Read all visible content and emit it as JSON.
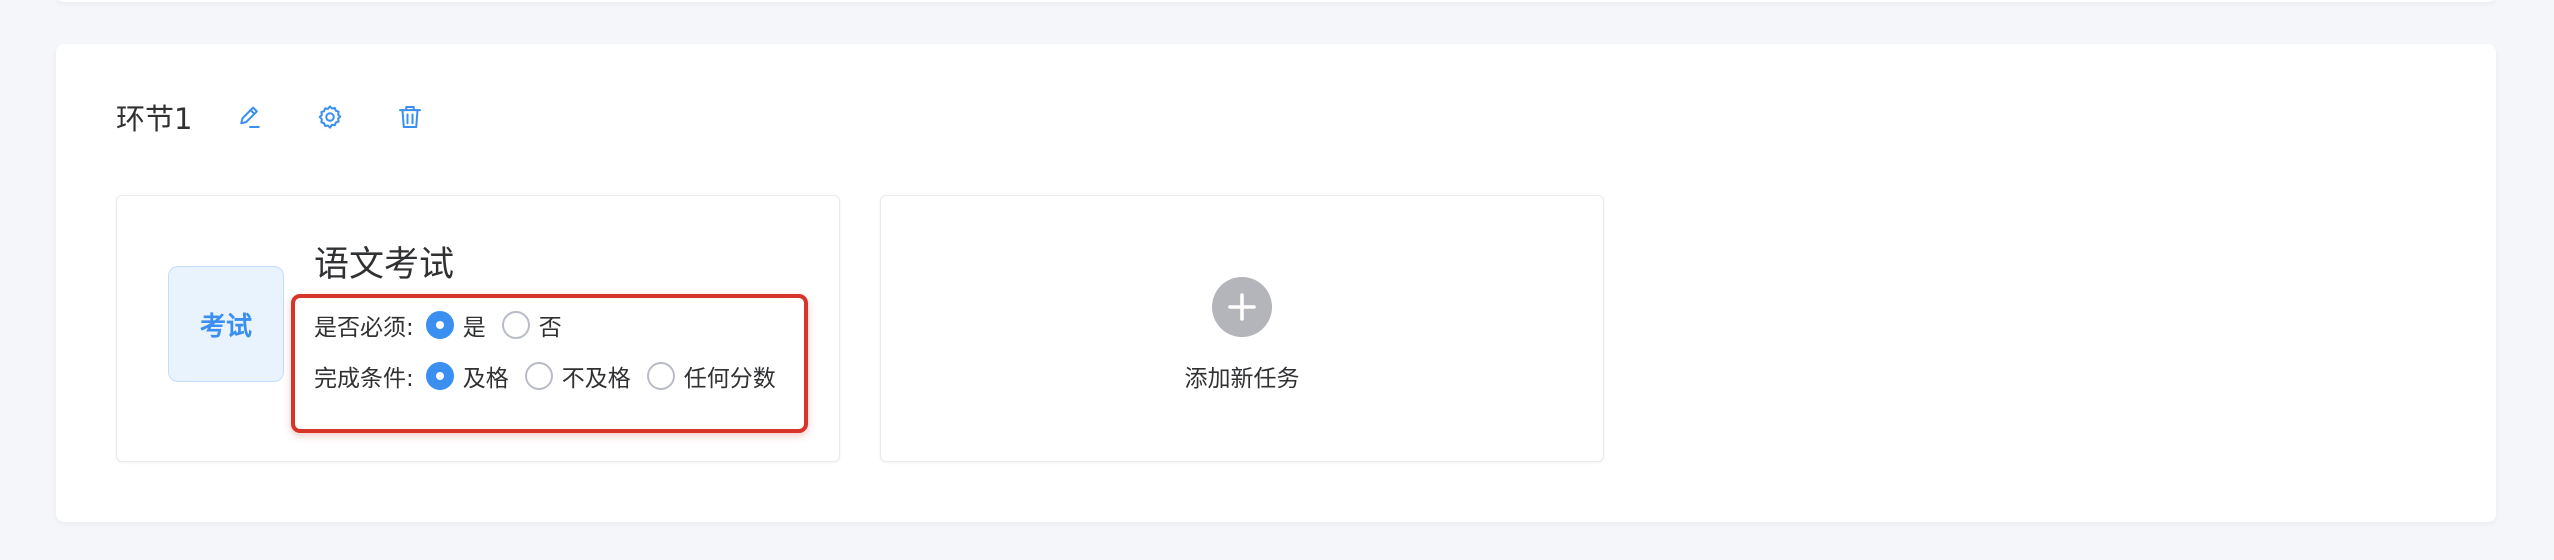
{
  "stage": {
    "title": "环节1",
    "icons": [
      "edit-icon",
      "gear-icon",
      "trash-icon"
    ]
  },
  "task": {
    "badge": "考试",
    "title": "语文考试",
    "required": {
      "label": "是否必须:",
      "options": [
        "是",
        "否"
      ],
      "selected": "是"
    },
    "completion": {
      "label": "完成条件:",
      "options": [
        "及格",
        "不及格",
        "任何分数"
      ],
      "selected": "及格"
    }
  },
  "add_task": {
    "label": "添加新任务",
    "icon": "plus-icon"
  },
  "colors": {
    "accent": "#3b8ff0",
    "highlight": "#d8352a",
    "background": "#f5f6fa"
  }
}
